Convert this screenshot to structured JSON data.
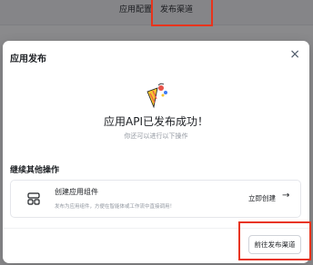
{
  "background": {
    "tabs": [
      {
        "label": "应用配置"
      },
      {
        "label": "发布渠道"
      }
    ]
  },
  "modal": {
    "title": "应用发布",
    "close_icon": "close-icon",
    "success_title": "应用API已发布成功！",
    "success_subtitle": "你还可以进行以下操作",
    "section_title": "继续其他操作",
    "card": {
      "icon": "component-icon",
      "name": "创建应用组件",
      "description": "发布为应用组件，方便在智能体或工作流中直接调用！",
      "action_label": "立即创建"
    },
    "footer_button": "前往发布渠道"
  },
  "colors": {
    "highlight": "#e8341c",
    "overlay": "rgba(22,22,26,0.5)",
    "text_primary": "#1c1f23",
    "text_secondary": "#8f959e"
  }
}
